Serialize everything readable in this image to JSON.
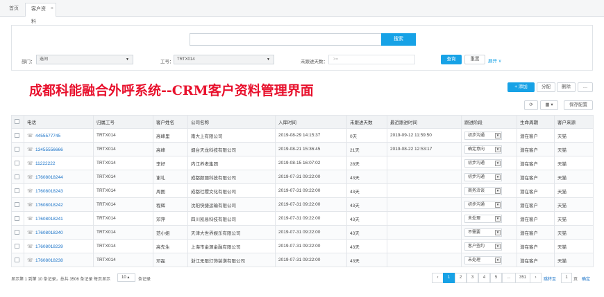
{
  "tabs": {
    "home": "首页",
    "active": "客户资料",
    "close": "×"
  },
  "search": {
    "placeholder": "",
    "button": "搜索"
  },
  "filters": {
    "dept_label": "部门：",
    "dept_value": "选间",
    "job_label": "工号：",
    "job_value": "TRTX014",
    "nofollow_label": "未跟进天数：",
    "nofollow_placeholder": ">=",
    "query": "查询",
    "reset": "重置",
    "expand": "展开 ∨"
  },
  "banner": "成都科能融合外呼系统--CRM客户资料管理界面",
  "toolbar": {
    "add": "+ 添加",
    "assign": "分配",
    "delete": "删除",
    "more": "…",
    "refresh": "⟳",
    "columns": "▦ ▾",
    "save_config": "保存配置"
  },
  "columns": [
    "",
    "电话",
    "归属工号",
    "客户姓名",
    "公司名称",
    "入库时间",
    "未跟进天数",
    "最近跟进时间",
    "跟进阶段",
    "生命周期",
    "客户来源"
  ],
  "rows": [
    {
      "phone": "4455577745",
      "agent": "TRTX014",
      "name": "高峰里",
      "company": "南大上有限公司",
      "created": "2019-08-29 14:15:37",
      "days": "0天",
      "last": "2019-09-12 11:59:50",
      "stage": "初步沟通",
      "life": "潜在客户",
      "source": "天猫"
    },
    {
      "phone": "13455556666",
      "agent": "TRTX014",
      "name": "高峰",
      "company": "烟台天龙科技有限公司",
      "created": "2019-08-21 15:36:45",
      "days": "21天",
      "last": "2019-08-22 12:53:17",
      "stage": "确定意向",
      "life": "潜在客户",
      "source": "天猫"
    },
    {
      "phone": "11222222",
      "agent": "TRTX014",
      "name": "李好",
      "company": "内江养老集团",
      "created": "2019-08-15 16:07:02",
      "days": "28天",
      "last": "",
      "stage": "初步沟通",
      "life": "潜在客户",
      "source": "天猫"
    },
    {
      "phone": "17608018244",
      "agent": "TRTX014",
      "name": "谢礼",
      "company": "成都颜丽科技有限公司",
      "created": "2019-07-31 09:22:00",
      "days": "43天",
      "last": "",
      "stage": "初步沟通",
      "life": "潜在客户",
      "source": "天猫"
    },
    {
      "phone": "17608018243",
      "agent": "TRTX014",
      "name": "周图",
      "company": "成都社稷文化有限公司",
      "created": "2019-07-31 09:22:00",
      "days": "43天",
      "last": "",
      "stage": "商务洽谈",
      "life": "潜在客户",
      "source": "天猫"
    },
    {
      "phone": "17608018242",
      "agent": "TRTX014",
      "name": "程辉",
      "company": "沈阳快捷运输有限公司",
      "created": "2019-07-31 09:22:00",
      "days": "43天",
      "last": "",
      "stage": "初步沟通",
      "life": "潜在客户",
      "source": "天猫"
    },
    {
      "phone": "17608018241",
      "agent": "TRTX014",
      "name": "邓萍",
      "company": "四川凯易科技有限公司",
      "created": "2019-07-31 09:22:00",
      "days": "43天",
      "last": "",
      "stage": "未处理",
      "life": "潜在客户",
      "source": "天猫"
    },
    {
      "phone": "17608018240",
      "agent": "TRTX014",
      "name": "范小姐",
      "company": "天津大世界娱乐有限公司",
      "created": "2019-07-31 09:22:00",
      "days": "43天",
      "last": "",
      "stage": "不需要",
      "life": "潜在客户",
      "source": "天猫"
    },
    {
      "phone": "17608018239",
      "agent": "TRTX014",
      "name": "高先生",
      "company": "上海市金源金融有限公司",
      "created": "2019-07-31 09:22:00",
      "days": "43天",
      "last": "",
      "stage": "客户签约",
      "life": "潜在客户",
      "source": "天猫"
    },
    {
      "phone": "17608018238",
      "agent": "TRTX014",
      "name": "邓磊",
      "company": "浙江无限灯饰装潢有限公司",
      "created": "2019-07-31 09:22:00",
      "days": "43天",
      "last": "",
      "stage": "未处理",
      "life": "潜在客户",
      "source": "天猫"
    }
  ],
  "footer": {
    "summary": "显示第 1 到第 10 条记录，总共 3506 条记录 每页显示",
    "page_size": "10 ▴",
    "suffix": "条记录",
    "pages": [
      "‹",
      "1",
      "2",
      "3",
      "4",
      "5",
      "...",
      "351",
      "›"
    ],
    "goto_label": "跳转至",
    "goto_value": "1",
    "page_unit": "页",
    "confirm": "确定"
  },
  "colors": {
    "accent": "#17a2e6",
    "banner": "#e8112d",
    "link": "#1a73c8"
  }
}
